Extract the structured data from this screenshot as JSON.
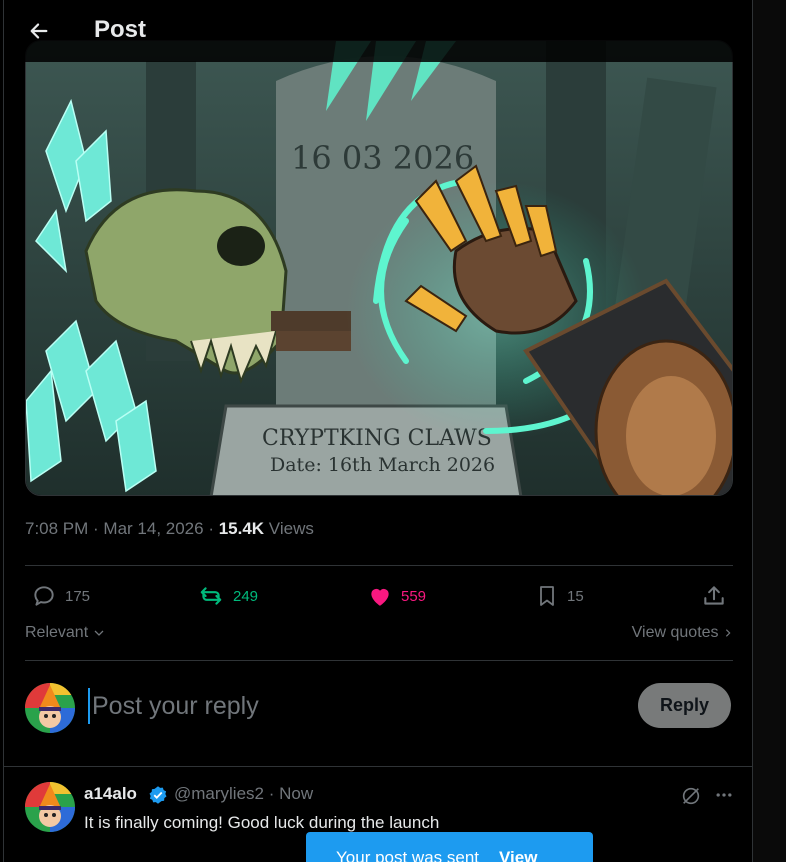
{
  "header": {
    "title": "Post"
  },
  "image": {
    "date_stone": "16 03 2026",
    "plaque_line1": "CRYPTKING CLAWS",
    "plaque_line2": "Date: 16th March 2026"
  },
  "meta": {
    "time": "7:08 PM · Mar 14, 2026 · ",
    "views_count": "15.4K",
    "views_label": " Views"
  },
  "actions": {
    "replies": "175",
    "reposts": "249",
    "likes": "559",
    "bookmarks": "15"
  },
  "colors": {
    "repost": "#00ba7c",
    "like": "#f91880",
    "accent": "#1d9bf0"
  },
  "sort": {
    "left": "Relevant",
    "right": "View quotes"
  },
  "composer": {
    "placeholder": "Post your reply",
    "button": "Reply"
  },
  "reply": {
    "name": "a14alo",
    "handle_time": "@marylies2 · Now",
    "text": "It is finally coming! Good luck during the launch"
  },
  "toast": {
    "message": "Your post was sent",
    "action": "View"
  }
}
